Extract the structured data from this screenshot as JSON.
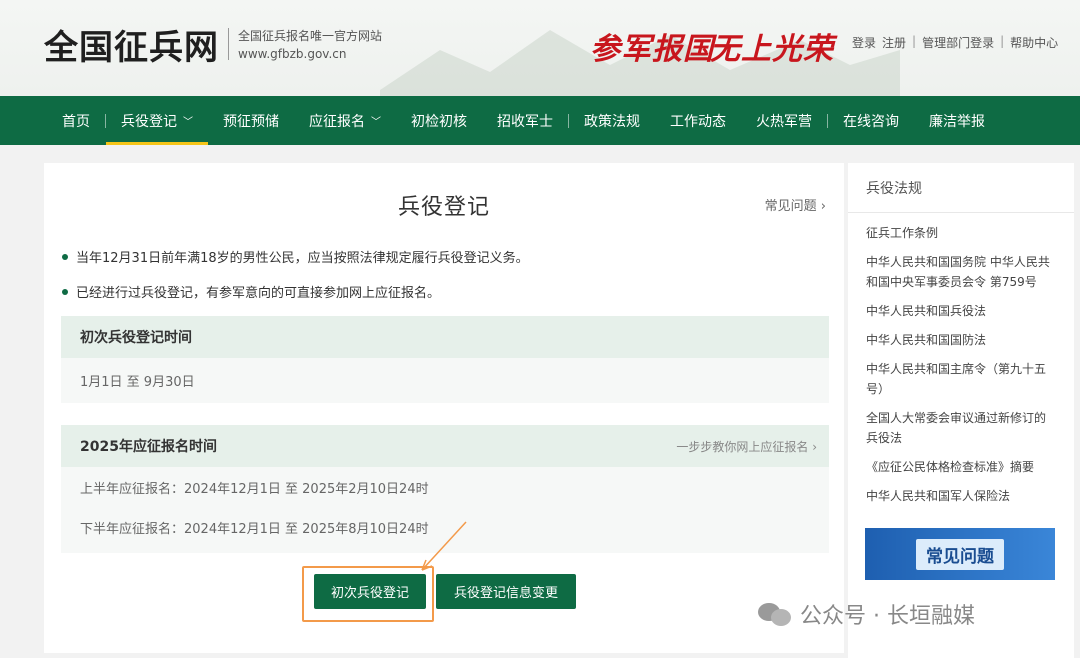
{
  "header": {
    "site_title": "全国征兵网",
    "sub_line1": "全国征兵报名唯一官方网站",
    "sub_line2": "www.gfbzb.gov.cn",
    "slogan1": "参军报国",
    "slogan2": "无上光荣",
    "links": {
      "login": "登录",
      "register": "注册",
      "admin_login": "管理部门登录",
      "help": "帮助中心"
    }
  },
  "nav": {
    "items": [
      {
        "label": "首页"
      },
      {
        "label": "兵役登记",
        "dropdown": true,
        "active": true
      },
      {
        "label": "预征预储"
      },
      {
        "label": "应征报名",
        "dropdown": true
      },
      {
        "label": "初检初核"
      },
      {
        "label": "招收军士"
      },
      {
        "label": "政策法规"
      },
      {
        "label": "工作动态"
      },
      {
        "label": "火热军营"
      },
      {
        "label": "在线咨询"
      },
      {
        "label": "廉洁举报"
      }
    ],
    "active_color": "#f5c518",
    "bg_color": "#0e6b44"
  },
  "main": {
    "title": "兵役登记",
    "faq_link": "常见问题",
    "bullets": [
      "当年12月31日前年满18岁的男性公民，应当按照法律规定履行兵役登记义务。",
      "已经进行过兵役登记，有参军意向的可直接参加网上应征报名。"
    ],
    "first_registration": {
      "title": "初次兵役登记时间",
      "period": "1月1日 至 9月30日"
    },
    "enlistment": {
      "title": "2025年应征报名时间",
      "guide_link": "一步步教你网上应征报名",
      "first_half": "上半年应征报名：2024年12月1日 至 2025年2月10日24时",
      "second_half": "下半年应征报名：2024年12月1日 至 2025年8月10日24时"
    },
    "buttons": {
      "first_register": "初次兵役登记",
      "info_change": "兵役登记信息变更"
    }
  },
  "sidebar": {
    "title": "兵役法规",
    "items": [
      "征兵工作条例",
      "中华人民共和国国务院 中华人民共和国中央军事委员会令 第759号",
      "中华人民共和国兵役法",
      "中华人民共和国国防法",
      "中华人民共和国主席令（第九十五号）",
      "全国人大常委会审议通过新修订的兵役法",
      "《应征公民体格检查标准》摘要",
      "中华人民共和国军人保险法"
    ],
    "banner": "常见问题"
  },
  "watermark": "公众号 · 长垣融媒"
}
